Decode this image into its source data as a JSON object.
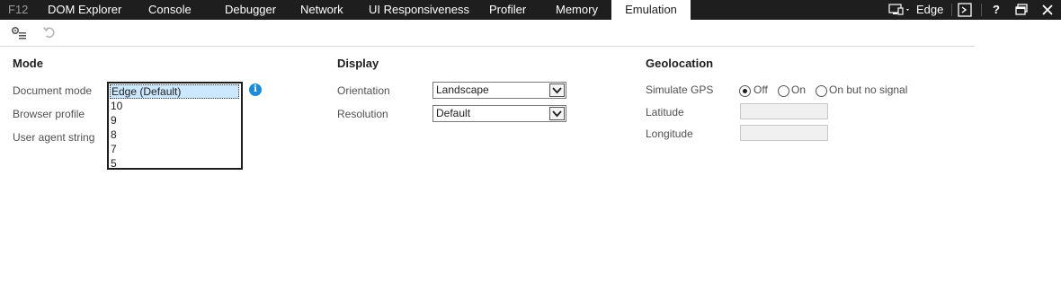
{
  "tabs": {
    "f12": "F12",
    "dom_explorer": "DOM Explorer",
    "console": "Console",
    "debugger": "Debugger",
    "network": "Network",
    "ui_responsiveness": "UI Responsiveness",
    "profiler": "Profiler",
    "memory": "Memory",
    "emulation": "Emulation"
  },
  "topbar": {
    "browser_target": "Edge",
    "help": "?"
  },
  "mode": {
    "heading": "Mode",
    "document_mode_label": "Document mode",
    "browser_profile_label": "Browser profile",
    "user_agent_label": "User agent string",
    "document_mode_options": [
      "Edge (Default)",
      "10",
      "9",
      "8",
      "7",
      "5"
    ],
    "selected_index": 0
  },
  "display": {
    "heading": "Display",
    "orientation_label": "Orientation",
    "orientation_value": "Landscape",
    "resolution_label": "Resolution",
    "resolution_value": "Default"
  },
  "geolocation": {
    "heading": "Geolocation",
    "simulate_gps_label": "Simulate GPS",
    "gps_options": [
      "Off",
      "On",
      "On but no signal"
    ],
    "selected_gps": "Off",
    "latitude_label": "Latitude",
    "latitude_value": "",
    "longitude_label": "Longitude",
    "longitude_value": ""
  },
  "colors": {
    "tabbar_bg": "#1e1e1e",
    "selected_option_bg": "#cce8ff",
    "info_icon": "#1e8bd9"
  }
}
